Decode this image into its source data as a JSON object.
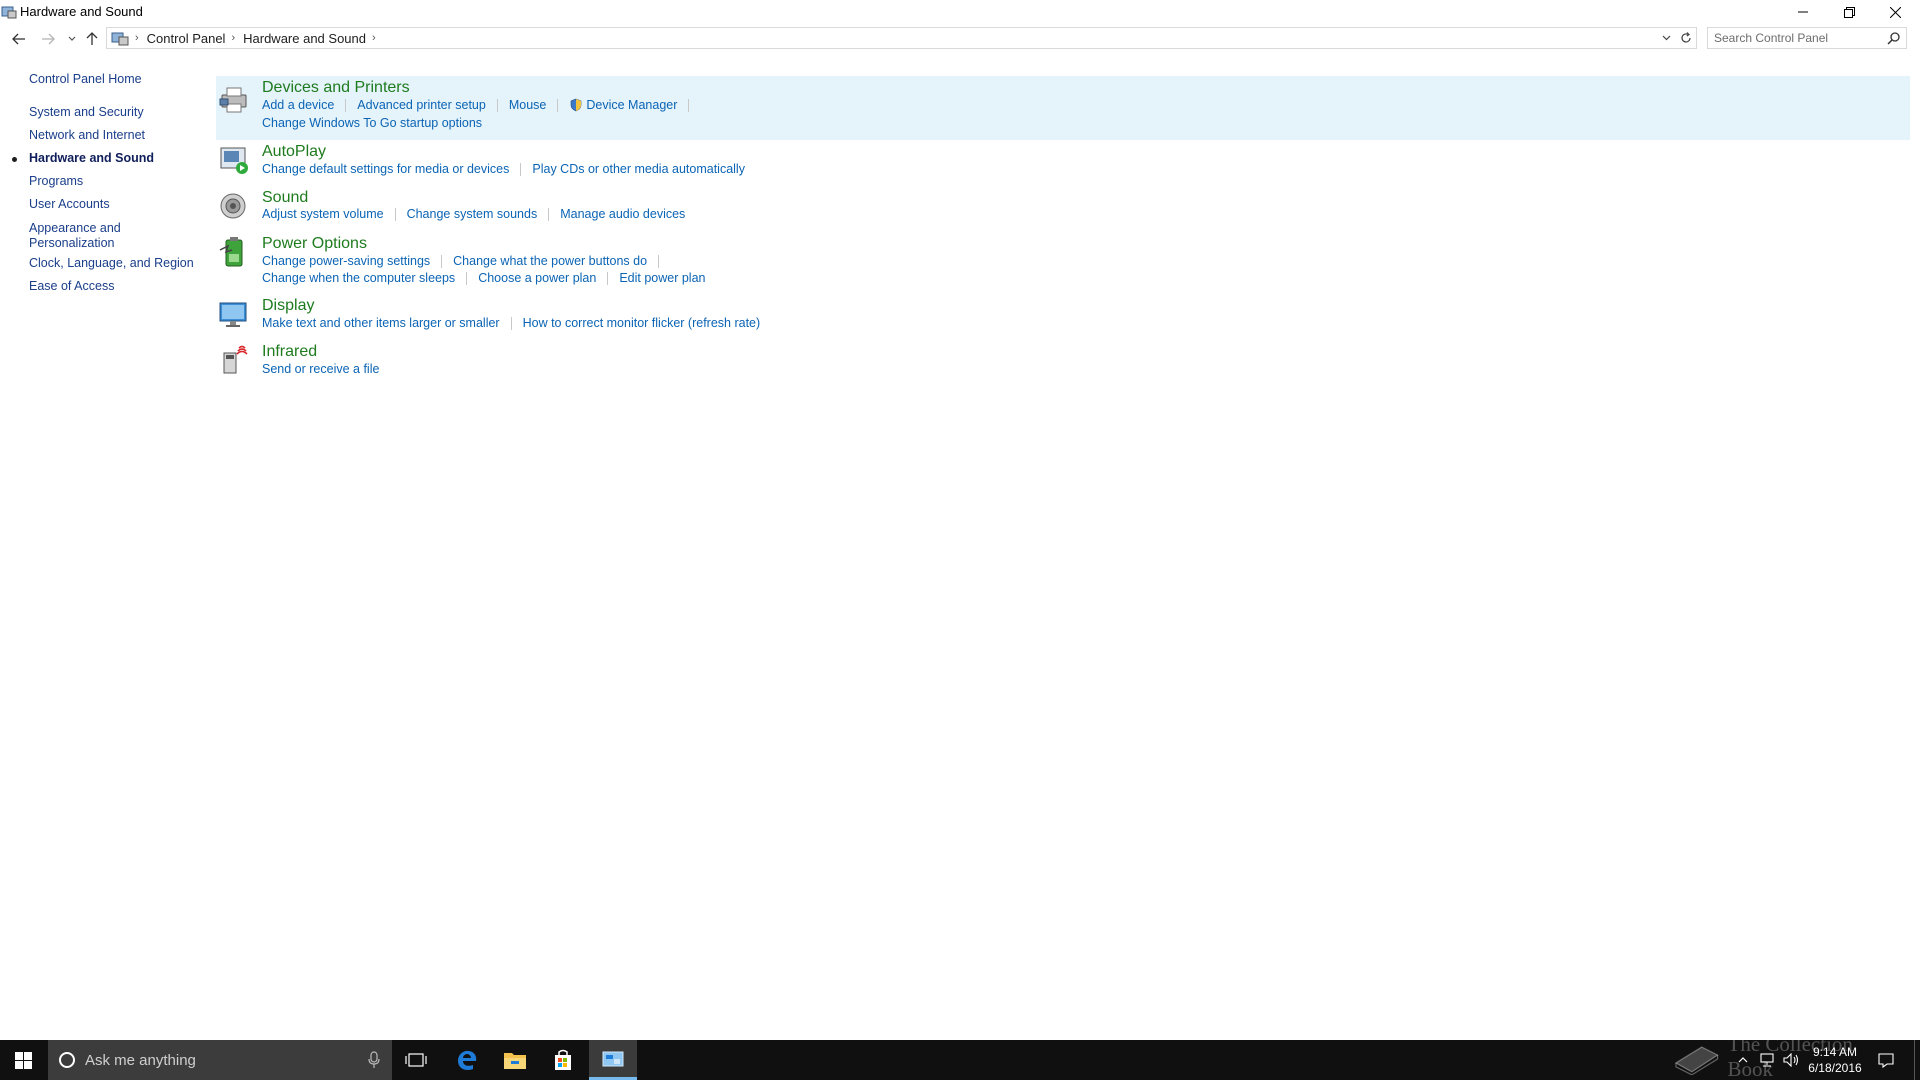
{
  "window": {
    "title": "Hardware and Sound",
    "app_icon": "control-panel-icon",
    "controls": [
      "minimize-icon",
      "restore-icon",
      "close-icon"
    ]
  },
  "address": {
    "breadcrumbs": [
      "Control Panel",
      "Hardware and Sound"
    ],
    "search_placeholder": "Search Control Panel"
  },
  "leftnav": {
    "items": [
      {
        "label": "Control Panel Home",
        "active": false
      },
      {
        "label": "System and Security",
        "active": false
      },
      {
        "label": "Network and Internet",
        "active": false
      },
      {
        "label": "Hardware and Sound",
        "active": true
      },
      {
        "label": "Programs",
        "active": false
      },
      {
        "label": "User Accounts",
        "active": false
      },
      {
        "label": "Appearance and Personalization",
        "active": false
      },
      {
        "label": "Clock, Language, and Region",
        "active": false
      },
      {
        "label": "Ease of Access",
        "active": false
      }
    ]
  },
  "categories": [
    {
      "title": "Devices and Printers",
      "icon": "printer-icon",
      "links": [
        [
          "Add a device",
          "Advanced printer setup",
          "Mouse",
          "Device Manager"
        ],
        [
          "Change Windows To Go startup options"
        ]
      ]
    },
    {
      "title": "AutoPlay",
      "icon": "autoplay-icon",
      "links": [
        [
          "Change default settings for media or devices",
          "Play CDs or other media automatically"
        ]
      ]
    },
    {
      "title": "Sound",
      "icon": "speaker-icon",
      "links": [
        [
          "Adjust system volume",
          "Change system sounds",
          "Manage audio devices"
        ]
      ]
    },
    {
      "title": "Power Options",
      "icon": "battery-icon",
      "links": [
        [
          "Change power-saving settings",
          "Change what the power buttons do"
        ],
        [
          "Change when the computer sleeps",
          "Choose a power plan",
          "Edit power plan"
        ]
      ]
    },
    {
      "title": "Display",
      "icon": "monitor-icon",
      "links": [
        [
          "Make text and other items larger or smaller",
          "How to correct monitor flicker (refresh rate)"
        ]
      ]
    },
    {
      "title": "Infrared",
      "icon": "infrared-icon",
      "links": [
        [
          "Send or receive a file"
        ]
      ]
    }
  ],
  "taskbar": {
    "search_placeholder": "Ask me anything",
    "time": "9:14 AM",
    "date": "6/18/2016",
    "watermark": "The Collection Book",
    "colors": {
      "background": "#101010",
      "search": "#3c3c3c",
      "active_underline": "#76b9ed"
    }
  },
  "colors": {
    "link": "#0b64b4",
    "category_title": "#1e7b1e",
    "nav_link": "#1a3e8a",
    "highlight": "#e5f3fb"
  }
}
